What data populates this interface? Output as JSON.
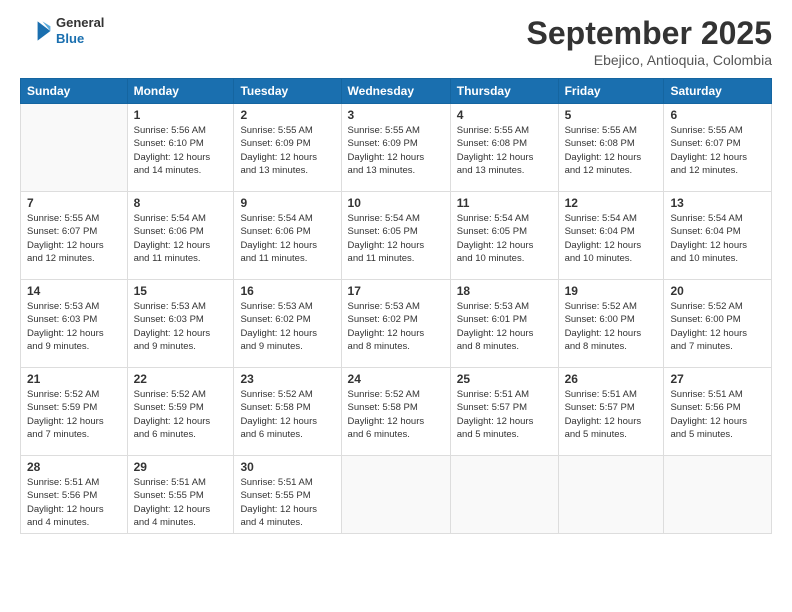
{
  "header": {
    "logo_line1": "General",
    "logo_line2": "Blue",
    "month": "September 2025",
    "location": "Ebejico, Antioquia, Colombia"
  },
  "weekdays": [
    "Sunday",
    "Monday",
    "Tuesday",
    "Wednesday",
    "Thursday",
    "Friday",
    "Saturday"
  ],
  "weeks": [
    [
      {
        "day": "",
        "info": ""
      },
      {
        "day": "1",
        "info": "Sunrise: 5:56 AM\nSunset: 6:10 PM\nDaylight: 12 hours\nand 14 minutes."
      },
      {
        "day": "2",
        "info": "Sunrise: 5:55 AM\nSunset: 6:09 PM\nDaylight: 12 hours\nand 13 minutes."
      },
      {
        "day": "3",
        "info": "Sunrise: 5:55 AM\nSunset: 6:09 PM\nDaylight: 12 hours\nand 13 minutes."
      },
      {
        "day": "4",
        "info": "Sunrise: 5:55 AM\nSunset: 6:08 PM\nDaylight: 12 hours\nand 13 minutes."
      },
      {
        "day": "5",
        "info": "Sunrise: 5:55 AM\nSunset: 6:08 PM\nDaylight: 12 hours\nand 12 minutes."
      },
      {
        "day": "6",
        "info": "Sunrise: 5:55 AM\nSunset: 6:07 PM\nDaylight: 12 hours\nand 12 minutes."
      }
    ],
    [
      {
        "day": "7",
        "info": "Sunrise: 5:55 AM\nSunset: 6:07 PM\nDaylight: 12 hours\nand 12 minutes."
      },
      {
        "day": "8",
        "info": "Sunrise: 5:54 AM\nSunset: 6:06 PM\nDaylight: 12 hours\nand 11 minutes."
      },
      {
        "day": "9",
        "info": "Sunrise: 5:54 AM\nSunset: 6:06 PM\nDaylight: 12 hours\nand 11 minutes."
      },
      {
        "day": "10",
        "info": "Sunrise: 5:54 AM\nSunset: 6:05 PM\nDaylight: 12 hours\nand 11 minutes."
      },
      {
        "day": "11",
        "info": "Sunrise: 5:54 AM\nSunset: 6:05 PM\nDaylight: 12 hours\nand 10 minutes."
      },
      {
        "day": "12",
        "info": "Sunrise: 5:54 AM\nSunset: 6:04 PM\nDaylight: 12 hours\nand 10 minutes."
      },
      {
        "day": "13",
        "info": "Sunrise: 5:54 AM\nSunset: 6:04 PM\nDaylight: 12 hours\nand 10 minutes."
      }
    ],
    [
      {
        "day": "14",
        "info": "Sunrise: 5:53 AM\nSunset: 6:03 PM\nDaylight: 12 hours\nand 9 minutes."
      },
      {
        "day": "15",
        "info": "Sunrise: 5:53 AM\nSunset: 6:03 PM\nDaylight: 12 hours\nand 9 minutes."
      },
      {
        "day": "16",
        "info": "Sunrise: 5:53 AM\nSunset: 6:02 PM\nDaylight: 12 hours\nand 9 minutes."
      },
      {
        "day": "17",
        "info": "Sunrise: 5:53 AM\nSunset: 6:02 PM\nDaylight: 12 hours\nand 8 minutes."
      },
      {
        "day": "18",
        "info": "Sunrise: 5:53 AM\nSunset: 6:01 PM\nDaylight: 12 hours\nand 8 minutes."
      },
      {
        "day": "19",
        "info": "Sunrise: 5:52 AM\nSunset: 6:00 PM\nDaylight: 12 hours\nand 8 minutes."
      },
      {
        "day": "20",
        "info": "Sunrise: 5:52 AM\nSunset: 6:00 PM\nDaylight: 12 hours\nand 7 minutes."
      }
    ],
    [
      {
        "day": "21",
        "info": "Sunrise: 5:52 AM\nSunset: 5:59 PM\nDaylight: 12 hours\nand 7 minutes."
      },
      {
        "day": "22",
        "info": "Sunrise: 5:52 AM\nSunset: 5:59 PM\nDaylight: 12 hours\nand 6 minutes."
      },
      {
        "day": "23",
        "info": "Sunrise: 5:52 AM\nSunset: 5:58 PM\nDaylight: 12 hours\nand 6 minutes."
      },
      {
        "day": "24",
        "info": "Sunrise: 5:52 AM\nSunset: 5:58 PM\nDaylight: 12 hours\nand 6 minutes."
      },
      {
        "day": "25",
        "info": "Sunrise: 5:51 AM\nSunset: 5:57 PM\nDaylight: 12 hours\nand 5 minutes."
      },
      {
        "day": "26",
        "info": "Sunrise: 5:51 AM\nSunset: 5:57 PM\nDaylight: 12 hours\nand 5 minutes."
      },
      {
        "day": "27",
        "info": "Sunrise: 5:51 AM\nSunset: 5:56 PM\nDaylight: 12 hours\nand 5 minutes."
      }
    ],
    [
      {
        "day": "28",
        "info": "Sunrise: 5:51 AM\nSunset: 5:56 PM\nDaylight: 12 hours\nand 4 minutes."
      },
      {
        "day": "29",
        "info": "Sunrise: 5:51 AM\nSunset: 5:55 PM\nDaylight: 12 hours\nand 4 minutes."
      },
      {
        "day": "30",
        "info": "Sunrise: 5:51 AM\nSunset: 5:55 PM\nDaylight: 12 hours\nand 4 minutes."
      },
      {
        "day": "",
        "info": ""
      },
      {
        "day": "",
        "info": ""
      },
      {
        "day": "",
        "info": ""
      },
      {
        "day": "",
        "info": ""
      }
    ]
  ]
}
